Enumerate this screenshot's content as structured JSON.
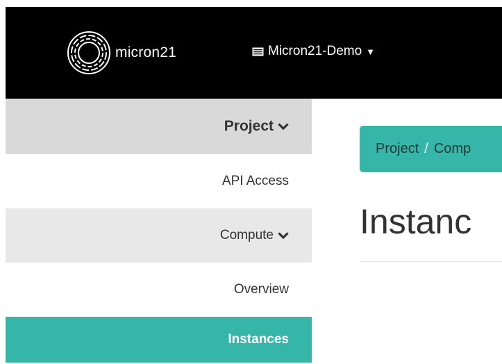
{
  "header": {
    "logo_text": "micron21",
    "project_name": "Micron21-Demo"
  },
  "sidebar": {
    "items": [
      {
        "label": "Project"
      },
      {
        "label": "API Access"
      },
      {
        "label": "Compute"
      },
      {
        "label": "Overview"
      },
      {
        "label": "Instances"
      }
    ]
  },
  "breadcrumb": {
    "items": [
      "Project",
      "Comp"
    ],
    "separator": "/"
  },
  "page": {
    "title": "Instanc"
  },
  "colors": {
    "accent": "#36b6a9",
    "topbar": "#000000"
  },
  "icons": {
    "logo": "micron21-logo-icon",
    "project": "project-icon",
    "caret": "caret-down-icon",
    "chevron": "chevron-down-icon"
  }
}
